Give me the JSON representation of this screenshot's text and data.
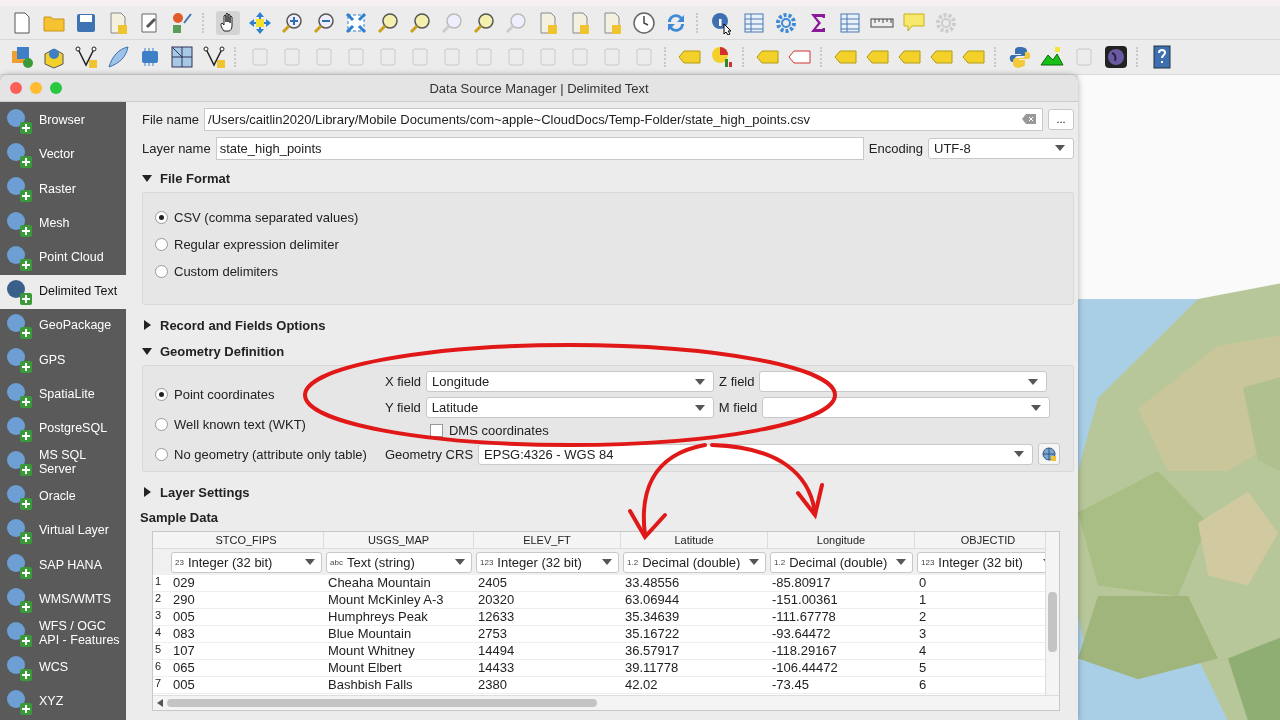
{
  "window": {
    "title": "Data Source Manager | Delimited Text"
  },
  "sidebar": {
    "items": [
      {
        "label": "Browser",
        "selected": false
      },
      {
        "label": "Vector",
        "selected": false
      },
      {
        "label": "Raster",
        "selected": false
      },
      {
        "label": "Mesh",
        "selected": false
      },
      {
        "label": "Point Cloud",
        "selected": false
      },
      {
        "label": "Delimited Text",
        "selected": true
      },
      {
        "label": "GeoPackage",
        "selected": false
      },
      {
        "label": "GPS",
        "selected": false
      },
      {
        "label": "SpatiaLite",
        "selected": false
      },
      {
        "label": "PostgreSQL",
        "selected": false
      },
      {
        "label": "MS SQL Server",
        "selected": false
      },
      {
        "label": "Oracle",
        "selected": false
      },
      {
        "label": "Virtual Layer",
        "selected": false
      },
      {
        "label": "SAP HANA",
        "selected": false
      },
      {
        "label": "WMS/WMTS",
        "selected": false
      },
      {
        "label": "WFS / OGC API - Features",
        "selected": false
      },
      {
        "label": "WCS",
        "selected": false
      },
      {
        "label": "XYZ",
        "selected": false
      }
    ]
  },
  "file_name": {
    "label": "File name",
    "value": "/Users/caitlin2020/Library/Mobile Documents/com~apple~CloudDocs/Temp-Folder/state_high_points.csv",
    "browse": "..."
  },
  "layer_name": {
    "label": "Layer name",
    "value": "state_high_points"
  },
  "encoding": {
    "label": "Encoding",
    "value": "UTF-8"
  },
  "file_format": {
    "title": "File Format",
    "expanded": true,
    "options": [
      {
        "label": "CSV (comma separated values)",
        "selected": true
      },
      {
        "label": "Regular expression delimiter",
        "selected": false
      },
      {
        "label": "Custom delimiters",
        "selected": false
      }
    ]
  },
  "record_options": {
    "title": "Record and Fields Options",
    "expanded": false
  },
  "geometry": {
    "title": "Geometry Definition",
    "expanded": true,
    "options": [
      {
        "label": "Point coordinates",
        "selected": true
      },
      {
        "label": "Well known text (WKT)",
        "selected": false
      },
      {
        "label": "No geometry (attribute only table)",
        "selected": false
      }
    ],
    "x_field": {
      "label": "X field",
      "value": "Longitude"
    },
    "y_field": {
      "label": "Y field",
      "value": "Latitude"
    },
    "z_field": {
      "label": "Z field"
    },
    "m_field": {
      "label": "M field"
    },
    "dms": {
      "label": "DMS coordinates",
      "checked": false
    },
    "crs": {
      "label": "Geometry CRS",
      "value": "EPSG:4326 - WGS 84"
    }
  },
  "layer_settings": {
    "title": "Layer Settings",
    "expanded": false
  },
  "sample_data": {
    "title": "Sample Data",
    "columns": [
      {
        "name": "STCO_FIPS",
        "badge": "23",
        "type": "Integer (32 bit)"
      },
      {
        "name": "USGS_MAP",
        "badge": "abc",
        "type": "Text (string)"
      },
      {
        "name": "ELEV_FT",
        "badge": "123",
        "type": "Integer (32 bit)"
      },
      {
        "name": "Latitude",
        "badge": "1.2",
        "type": "Decimal (double)"
      },
      {
        "name": "Longitude",
        "badge": "1.2",
        "type": "Decimal (double)"
      },
      {
        "name": "OBJECTID",
        "badge": "123",
        "type": "Integer (32 bit)"
      }
    ],
    "rows": [
      {
        "number": "1",
        "cells": [
          "029",
          "Cheaha Mountain",
          "2405",
          "33.48556",
          "-85.80917",
          "0"
        ]
      },
      {
        "number": "2",
        "cells": [
          "290",
          "Mount McKinley A-3",
          "20320",
          "63.06944",
          "-151.00361",
          "1"
        ]
      },
      {
        "number": "3",
        "cells": [
          "005",
          "Humphreys Peak",
          "12633",
          "35.34639",
          "-111.67778",
          "2"
        ]
      },
      {
        "number": "4",
        "cells": [
          "083",
          "Blue Mountain",
          "2753",
          "35.16722",
          "-93.64472",
          "3"
        ]
      },
      {
        "number": "5",
        "cells": [
          "107",
          "Mount Whitney",
          "14494",
          "36.57917",
          "-118.29167",
          "4"
        ]
      },
      {
        "number": "6",
        "cells": [
          "065",
          "Mount Elbert",
          "14433",
          "39.11778",
          "-106.44472",
          "5"
        ]
      },
      {
        "number": "7",
        "cells": [
          "005",
          "Bashbish Falls",
          "2380",
          "42.02",
          "-73.45",
          "6"
        ]
      }
    ]
  }
}
